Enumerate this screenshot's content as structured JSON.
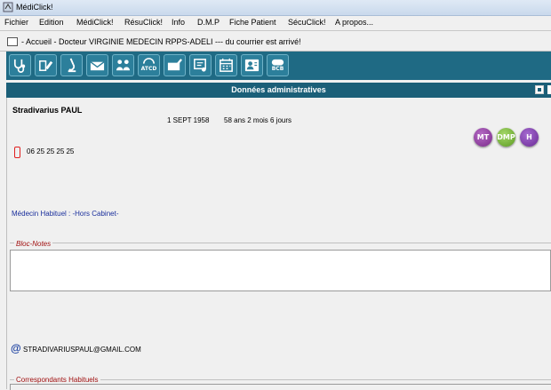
{
  "window": {
    "title": "MédiClick!"
  },
  "menu": [
    "Fichier",
    "Edition",
    "MédiClick!",
    "RésuClick!",
    "Info",
    "D.M.P",
    "Fiche Patient",
    "SécuClick!",
    "A propos..."
  ],
  "doc_tab": {
    "title": " - Accueil - Docteur VIRGINIE MEDECIN RPPS-ADELI --- du courrier est arrivé!"
  },
  "toolbar": [
    {
      "name": "stethoscope-icon",
      "label": ""
    },
    {
      "name": "prescription-icon",
      "label": ""
    },
    {
      "name": "microscope-icon",
      "label": ""
    },
    {
      "name": "mail-icon",
      "label": ""
    },
    {
      "name": "patients-icon",
      "label": ""
    },
    {
      "name": "atcd-icon",
      "label": "ATCD"
    },
    {
      "name": "courrier-icon",
      "label": ""
    },
    {
      "name": "certificate-icon",
      "label": ""
    },
    {
      "name": "calendar-icon",
      "label": ""
    },
    {
      "name": "id-card-icon",
      "label": ""
    },
    {
      "name": "bcb-icon",
      "label": "BCB"
    }
  ],
  "header": {
    "title": "Données administratives"
  },
  "patient": {
    "name": "Stradivarius PAUL",
    "dob": "1 SEPT 1958",
    "age": "58 ans 2 mois 6 jours",
    "phone": "06 25 25 25 25",
    "medecin_habituel": "Médecin Habituel : -Hors Cabinet-",
    "email": "STRADIVARIUSPAUL@GMAIL.COM"
  },
  "badges": [
    {
      "label": "MT",
      "color": "#8a2a9a"
    },
    {
      "label": "DMP",
      "color": "#6ab02a"
    },
    {
      "label": "H",
      "color": "#7a2aa0"
    }
  ],
  "sections": {
    "bloc_notes": "Bloc-Notes",
    "correspondants": "Correspondants Habituels"
  },
  "colors": {
    "toolbar": "#1f6a84",
    "header": "#1b5f78",
    "link_blue": "#1a2f9c",
    "section_red": "#a01010"
  }
}
